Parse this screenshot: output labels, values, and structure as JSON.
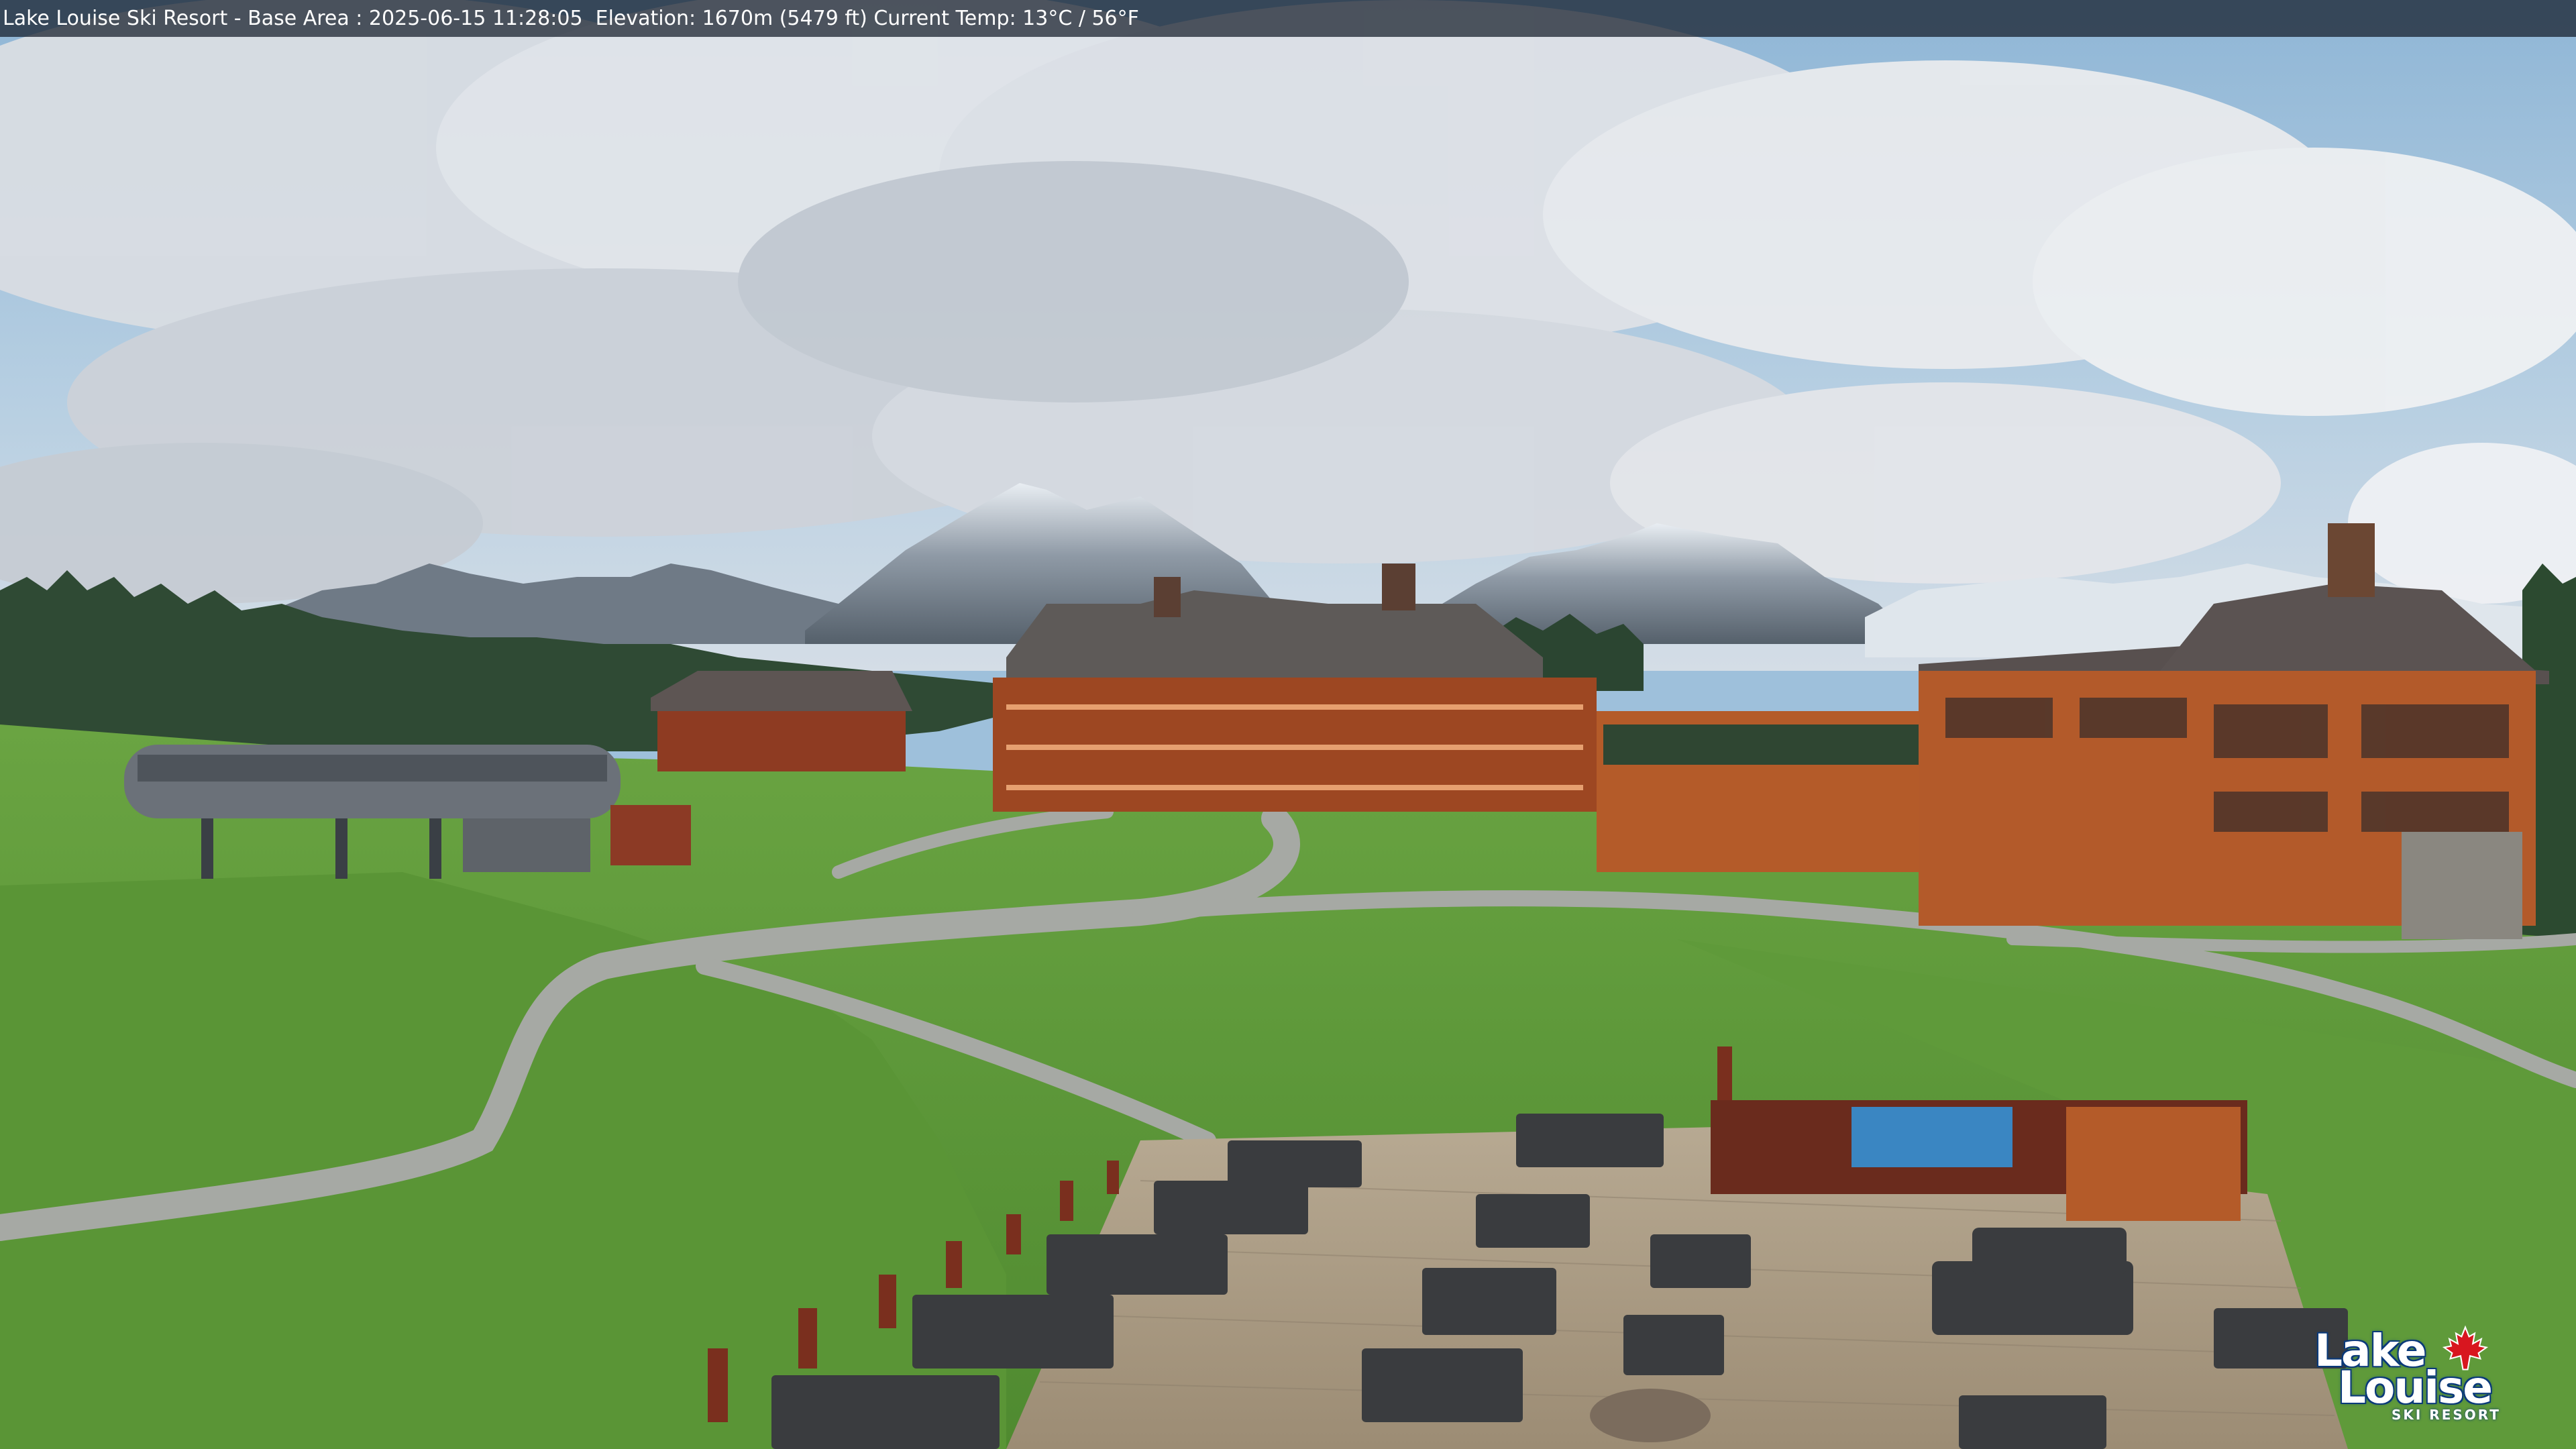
{
  "camera_overlay": {
    "caption": "Lake Louise Ski Resort - Base Area : 2025-06-15 11:28:05  Elevation: 1670m (5479 ft) Current Temp: 13°C / 56°F"
  },
  "logo": {
    "line1": "Lake",
    "line2": "Louise",
    "line3": "SKI RESORT",
    "icon": "maple-leaf-icon",
    "accent_color": "#d8161f",
    "outline_color": "#0b3a7a"
  },
  "colors": {
    "sky": "#9ec0db",
    "grass": "#5f9a3a",
    "lodge_wood": "#b0562a",
    "deck": "#a89a86"
  }
}
